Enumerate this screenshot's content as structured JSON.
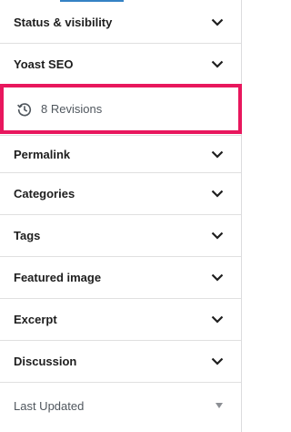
{
  "panels": [
    {
      "key": "status",
      "label": "Status & visibility"
    },
    {
      "key": "yoast",
      "label": "Yoast SEO"
    },
    {
      "key": "permalink",
      "label": "Permalink"
    },
    {
      "key": "categories",
      "label": "Categories"
    },
    {
      "key": "tags",
      "label": "Tags"
    },
    {
      "key": "featured",
      "label": "Featured image"
    },
    {
      "key": "excerpt",
      "label": "Excerpt"
    },
    {
      "key": "discussion",
      "label": "Discussion"
    }
  ],
  "revisions": {
    "label": "8 Revisions",
    "icon": "history-icon",
    "highlight_color": "#e8175d"
  },
  "last_updated": {
    "label": "Last Updated"
  },
  "colors": {
    "accent": "#3582c4",
    "text": "#1e1e1e",
    "muted": "#50575e",
    "divider": "#e0e0e0"
  }
}
